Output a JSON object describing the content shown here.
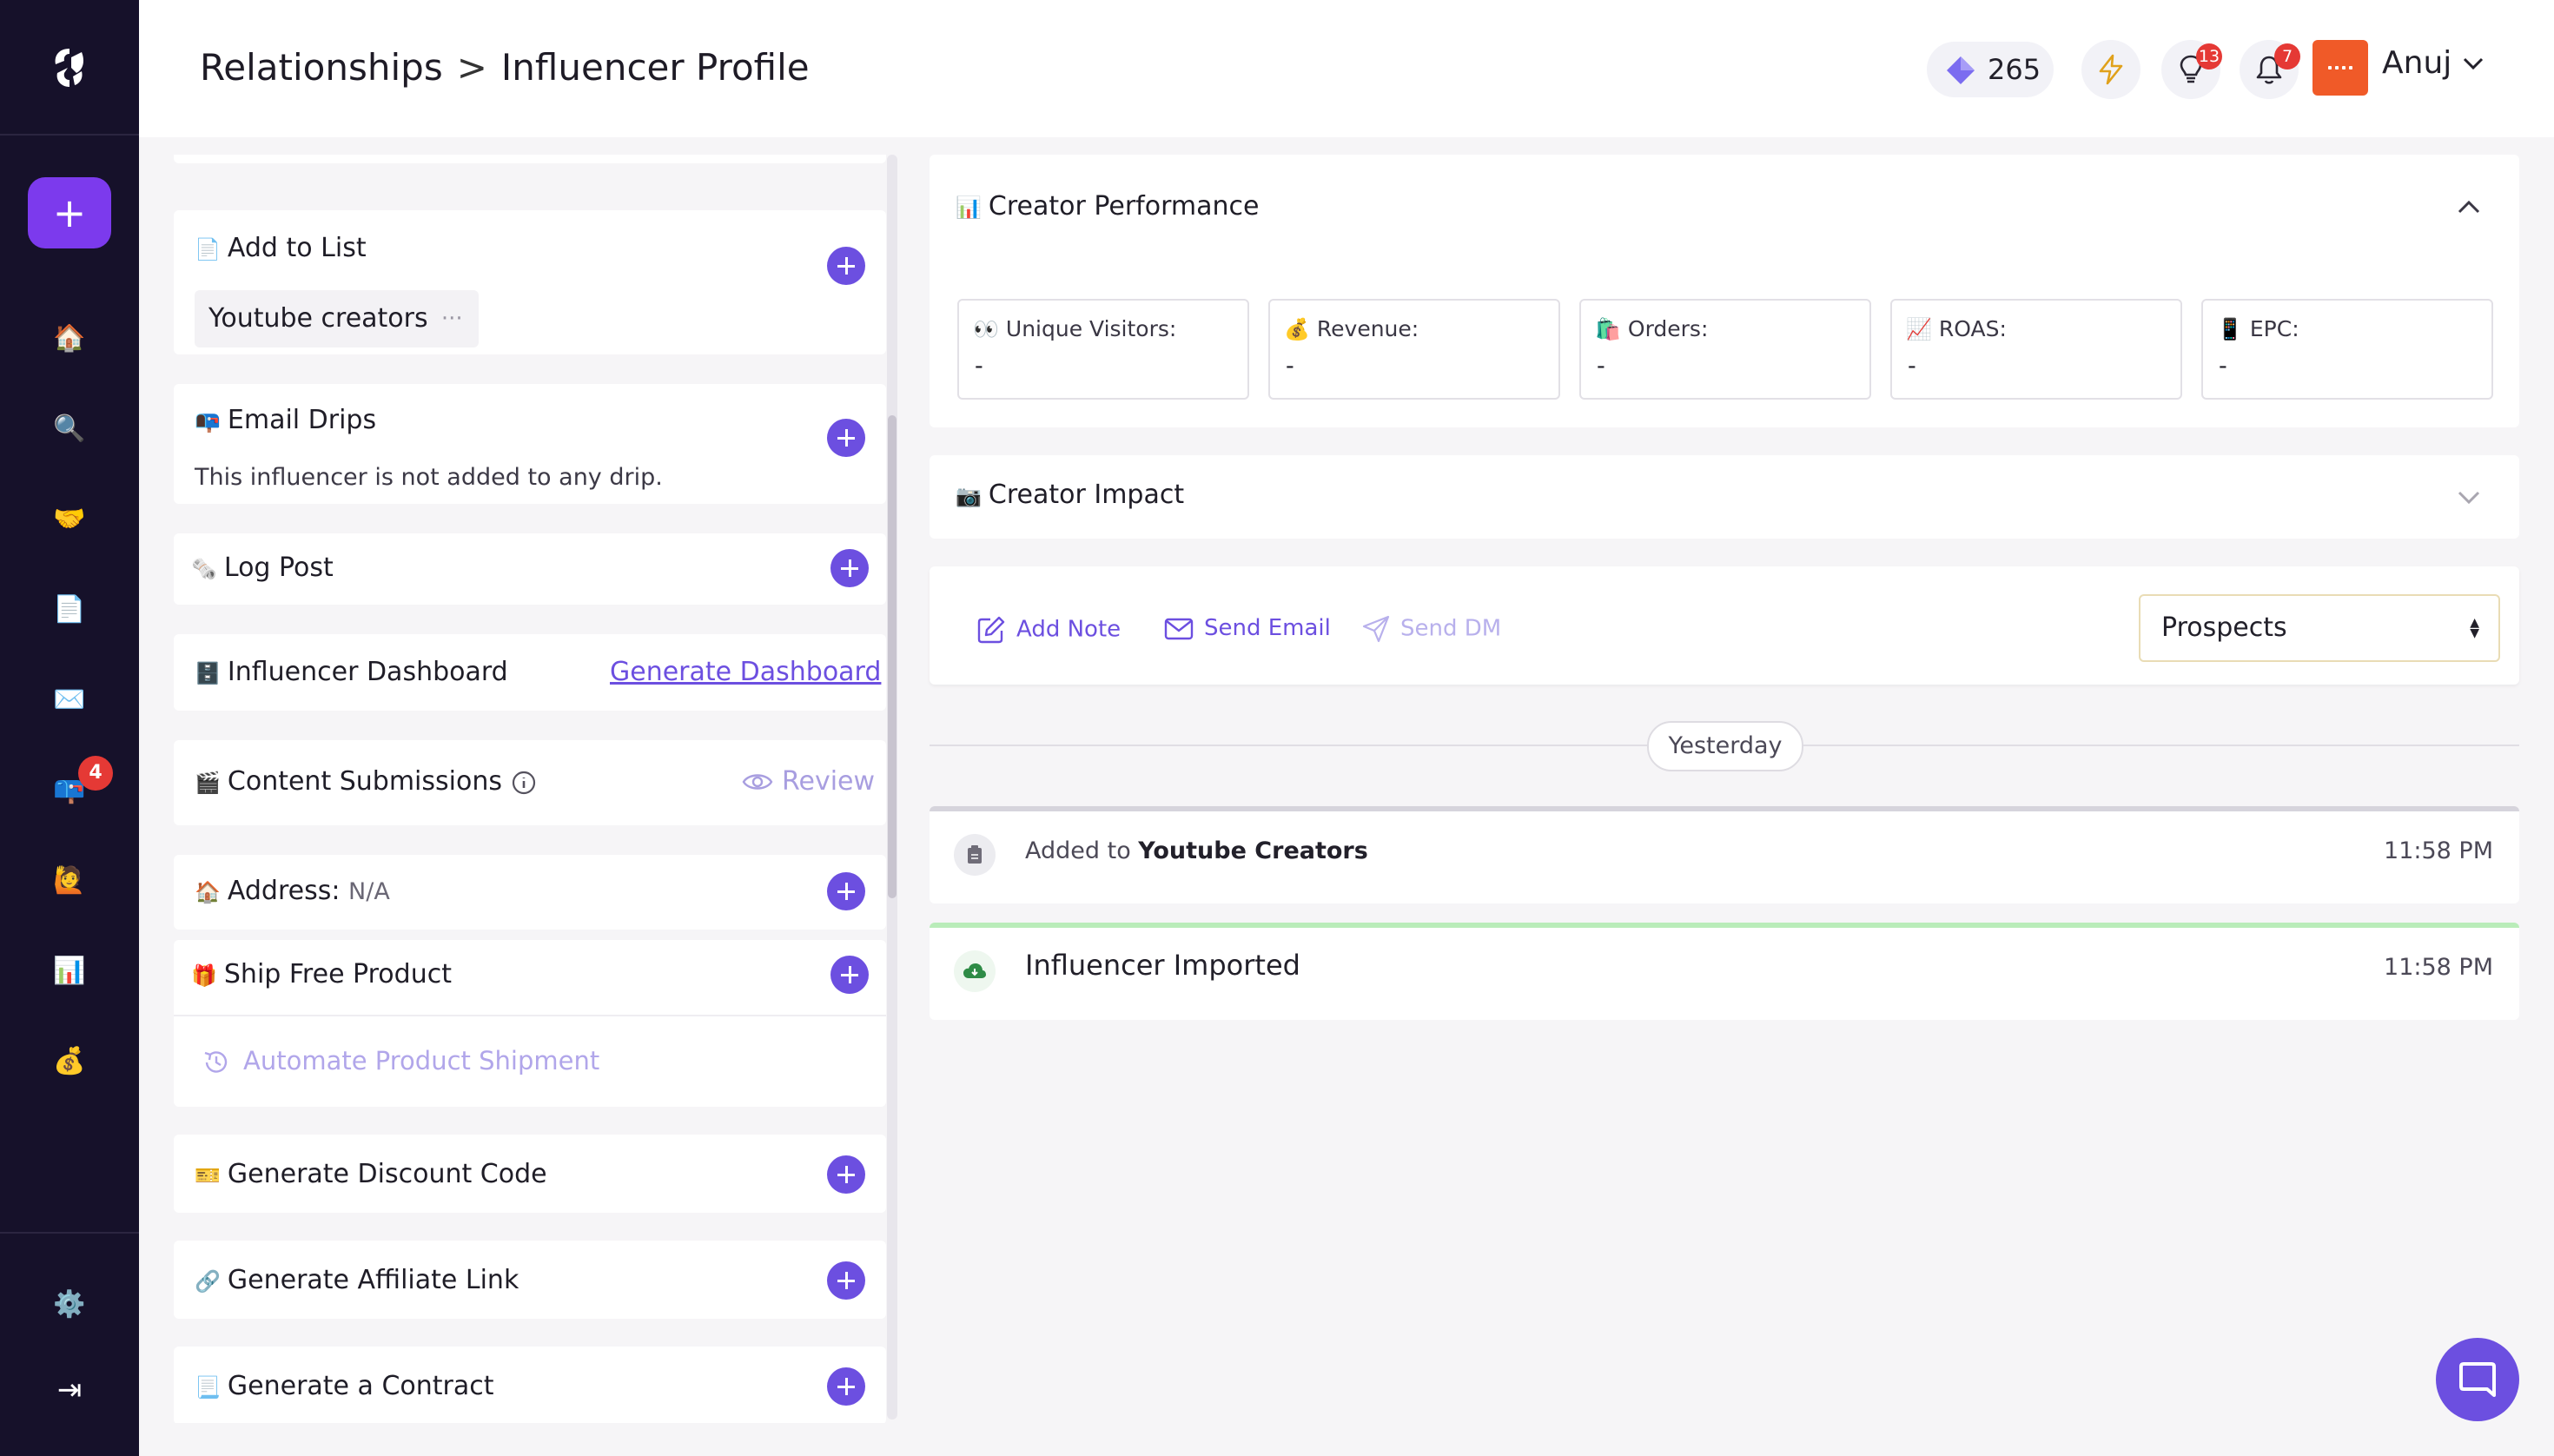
{
  "header": {
    "breadcrumb_parent": "Relationships",
    "breadcrumb_sep": ">",
    "breadcrumb_current": "Influencer Profile",
    "credits": "265",
    "ideas_badge": "13",
    "notifications_badge": "7",
    "user_name": "Anuj"
  },
  "sidebar": {
    "add_label": "+",
    "outreach_badge": "4",
    "items": [
      {
        "icon": "home-icon",
        "glyph": "🏠"
      },
      {
        "icon": "search-icon",
        "glyph": "🔍"
      },
      {
        "icon": "handshake-icon",
        "glyph": "🤝"
      },
      {
        "icon": "document-icon",
        "glyph": "📄"
      },
      {
        "icon": "envelope-icon",
        "glyph": "✉️"
      },
      {
        "icon": "outreach-icon",
        "glyph": "📪"
      },
      {
        "icon": "influencer-icon",
        "glyph": "🙋"
      },
      {
        "icon": "analytics-icon",
        "glyph": "📊"
      },
      {
        "icon": "money-bag-icon",
        "glyph": "💰"
      }
    ],
    "settings_glyph": "⚙️",
    "collapse_glyph": "⇥"
  },
  "left": {
    "add_to_list": {
      "emoji": "📄",
      "title": "Add to List",
      "tag": "Youtube creators",
      "tag_more": "···"
    },
    "email_drips": {
      "emoji": "📭",
      "title": "Email Drips",
      "text": "This influencer is not added to any drip."
    },
    "log_post": {
      "emoji": "🗞️",
      "title": "Log Post"
    },
    "dashboard": {
      "emoji": "🗄️",
      "title": "Influencer Dashboard",
      "link": "Generate Dashboard"
    },
    "content_submissions": {
      "emoji": "🎬",
      "title": "Content Submissions",
      "review": "Review"
    },
    "address": {
      "emoji": "🏠",
      "title": "Address:",
      "value": "N/A"
    },
    "ship_product": {
      "emoji": "🎁",
      "title": "Ship Free Product",
      "automate": "Automate Product Shipment"
    },
    "discount": {
      "emoji": "🎫",
      "title": "Generate Discount Code"
    },
    "affiliate": {
      "emoji": "🔗",
      "title": "Generate Affiliate Link"
    },
    "contract": {
      "emoji": "📃",
      "title": "Generate a Contract"
    }
  },
  "right": {
    "performance": {
      "emoji": "📊",
      "title": "Creator Performance",
      "metrics": [
        {
          "emoji": "👀",
          "label": "Unique Visitors:",
          "value": "-"
        },
        {
          "emoji": "💰",
          "label": "Revenue:",
          "value": "-"
        },
        {
          "emoji": "🛍️",
          "label": "Orders:",
          "value": "-"
        },
        {
          "emoji": "📈",
          "label": "ROAS:",
          "value": "-"
        },
        {
          "emoji": "📱",
          "label": "EPC:",
          "value": "-"
        }
      ]
    },
    "impact": {
      "emoji": "📷",
      "title": "Creator Impact"
    },
    "actions": {
      "add_note": "Add Note",
      "send_email": "Send Email",
      "send_dm": "Send DM",
      "stage": "Prospects"
    },
    "timeline": {
      "day": "Yesterday",
      "events": [
        {
          "prefix": "Added to ",
          "bold": "Youtube Creators",
          "time": "11:58 PM"
        },
        {
          "title": "Influencer Imported",
          "time": "11:58 PM"
        }
      ]
    }
  },
  "colors": {
    "accent": "#6c4fe0",
    "sidebar": "#16112a",
    "badge": "#e53935",
    "avatar": "#f05a28"
  }
}
